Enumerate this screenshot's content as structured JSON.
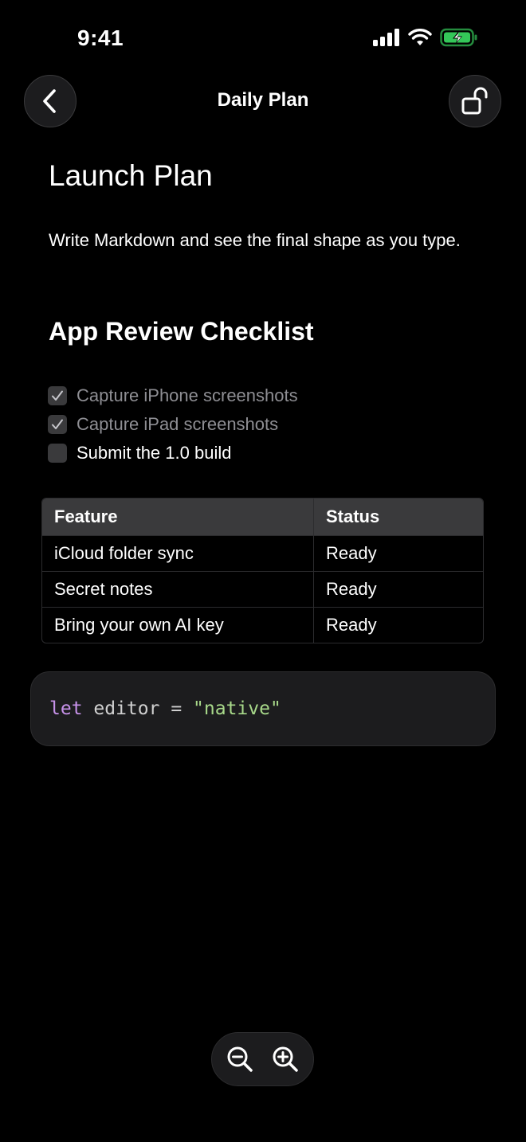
{
  "status_bar": {
    "time": "9:41"
  },
  "nav": {
    "title": "Daily Plan"
  },
  "document": {
    "title": "Launch Plan",
    "intro": "Write Markdown and see the final shape as you type.",
    "checklist_heading": "App Review Checklist",
    "checklist": [
      {
        "label": "Capture iPhone screenshots",
        "checked": true
      },
      {
        "label": "Capture iPad screenshots",
        "checked": true
      },
      {
        "label": "Submit the 1.0 build",
        "checked": false
      }
    ],
    "table": {
      "headers": [
        "Feature",
        "Status"
      ],
      "rows": [
        [
          "iCloud folder sync",
          "Ready"
        ],
        [
          "Secret notes",
          "Ready"
        ],
        [
          "Bring your own AI key",
          "Ready"
        ]
      ]
    },
    "code": {
      "keyword": "let",
      "identifier": " editor = ",
      "string": "\"native\""
    }
  },
  "icons": {
    "back": "chevron-left-icon",
    "lock": "unlock-icon",
    "zoom_out": "zoom-out-icon",
    "zoom_in": "zoom-in-icon"
  },
  "colors": {
    "background": "#000000",
    "keyword": "#c792ea",
    "string": "#a8d98a",
    "battery": "#34c759"
  }
}
